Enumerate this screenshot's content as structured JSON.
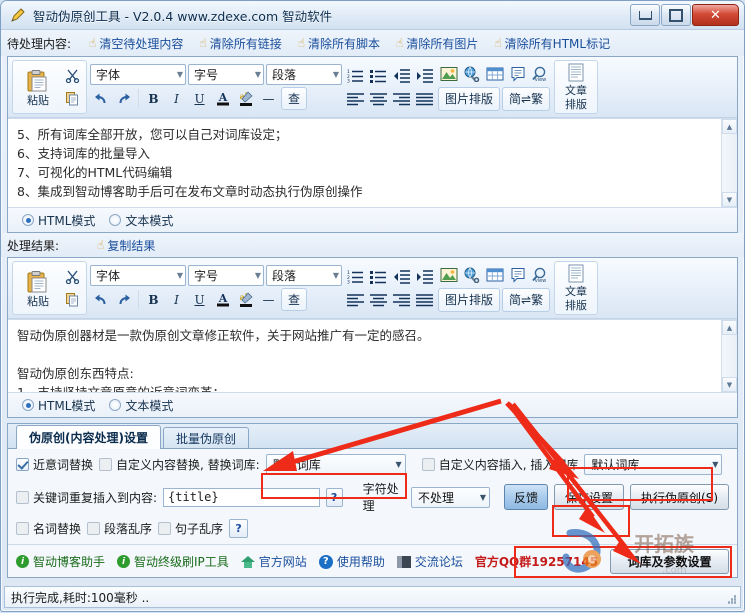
{
  "window": {
    "title": "智动伪原创工具  - V2.0.4  www.zdexe.com 智动软件",
    "icon": "pencil-icon",
    "minimize_label": "最小化",
    "maximize_label": "最大化",
    "close_label": "✕"
  },
  "source_section": {
    "label": "待处理内容:",
    "actions": [
      {
        "label": "清空待处理内容",
        "icon": "hand-icon"
      },
      {
        "label": "清除所有链接",
        "icon": "hand-icon"
      },
      {
        "label": "清除所有脚本",
        "icon": "hand-icon"
      },
      {
        "label": "清除所有图片",
        "icon": "hand-icon"
      },
      {
        "label": "清除所有HTML标记",
        "icon": "hand-icon"
      }
    ]
  },
  "result_section": {
    "label": "处理结果:",
    "actions": [
      {
        "label": "复制结果",
        "icon": "hand-icon"
      }
    ]
  },
  "ribbon": {
    "paste_label": "粘贴",
    "cut_label": "剪切",
    "copy_label": "复制",
    "undo_label": "撤销",
    "redo_label": "重做",
    "font_family": "字体",
    "font_size": "字号",
    "paragraph": "段落",
    "bold": "B",
    "italic": "I",
    "underline": "U",
    "font_color": "A",
    "highlight": "ab",
    "hr": "—",
    "find": "查",
    "ordered_list": "有序列表",
    "unordered_list": "无序列表",
    "outdent": "减少缩进",
    "indent": "增加缩进",
    "align_left": "左对齐",
    "align_center": "居中",
    "align_right": "右对齐",
    "align_justify": "两端对齐",
    "insert_image": "插入图片",
    "insert_link": "插入链接",
    "insert_table": "插入表格",
    "insert_comment": "插入批注",
    "view_source": "查看源码",
    "image_layout": "图片排版",
    "simp_trad": "简⇌繁",
    "article_layout_line1": "文章",
    "article_layout_line2": "排版"
  },
  "source_text": [
    "5、所有词库全部开放，您可以自己对词库设定；",
    "6、支持词库的批量导入",
    "7、可视化的HTML代码编辑",
    "8、集成到智动博客助手后可在发布文章时动态执行伪原创操作"
  ],
  "result_text": [
    "智动伪原创器材是一款伪原创文章修正软件，关于网站推广有一定的感召。",
    "",
    "智动伪原创东西特点:",
    "1、支持坚持文章原意的近意词变革；"
  ],
  "mode": {
    "html_label": "HTML模式",
    "text_label": "文本模式",
    "selected": "HTML模式"
  },
  "tabs": [
    {
      "label": "伪原创(内容处理)设置",
      "active": true
    },
    {
      "label": "批量伪原创",
      "active": false
    }
  ],
  "settings": {
    "synonym_replace": {
      "label": "近意词替换",
      "checked": true
    },
    "custom_replace": {
      "label": "自定义内容替换, 替换词库:",
      "checked": false
    },
    "replace_lib": {
      "value": "默认词库"
    },
    "custom_insert": {
      "label": "自定义内容插入, 插入词库",
      "checked": false
    },
    "insert_lib": {
      "value": "默认词库"
    },
    "keyword_repeat": {
      "label": "关键词重复插入到内容:",
      "checked": false,
      "value": "{title}"
    },
    "help_mark": "?",
    "char_process_label": "字符处理",
    "char_process_value": "不处理",
    "noun_replace": {
      "label": "名词替换",
      "checked": false
    },
    "para_shuffle": {
      "label": "段落乱序",
      "checked": false
    },
    "sentence_shuffle": {
      "label": "句子乱序",
      "checked": false
    },
    "feedback_button": "反馈",
    "save_button": "保存设置",
    "run_button": "执行伪原创(S)",
    "lib_params_button": "词库及参数设置"
  },
  "bottom_links": [
    {
      "label": "智动博客助手",
      "icon": "info-circle-icon",
      "color": "green"
    },
    {
      "label": "智动终级刷IP工具",
      "icon": "info-circle-icon",
      "color": "green"
    },
    {
      "label": "官方网站",
      "icon": "home-icon",
      "color": "blue"
    },
    {
      "label": "使用帮助",
      "icon": "question-circle-icon",
      "color": "blue"
    },
    {
      "label": "交流论坛",
      "icon": "book-icon",
      "color": "blue"
    }
  ],
  "qq_group": "官方QQ群19257145",
  "status": "执行完成,耗时:100毫秒  ..",
  "watermark": "开拓族",
  "colors": {
    "annotation": "#ee2b18",
    "link": "#1a4e9c",
    "green_link": "#1a6b1a",
    "qq_red": "#c41a1a"
  }
}
